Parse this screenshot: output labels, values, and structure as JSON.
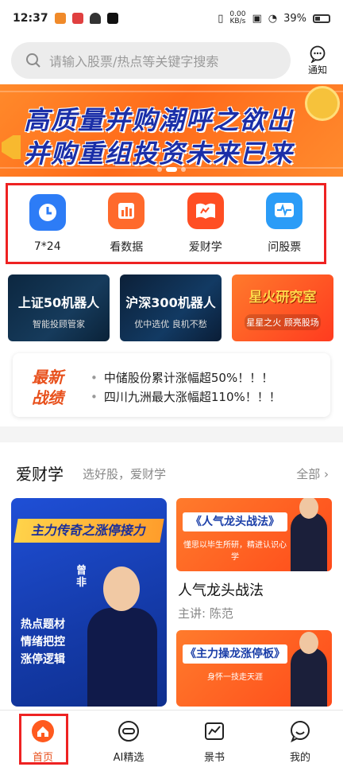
{
  "status": {
    "time": "12:37",
    "speed": "0.00",
    "speed_unit": "KB/s",
    "battery": "39%"
  },
  "search": {
    "placeholder": "请输入股票/热点等关键字搜索",
    "notify_label": "通知"
  },
  "banner": {
    "line1": "高质量并购潮呼之欲出",
    "line2": "并购重组投资未来已来"
  },
  "quick": {
    "items": [
      {
        "label": "7*24",
        "icon": "clock-icon",
        "color": "#2d7cf6"
      },
      {
        "label": "看数据",
        "icon": "chart-icon",
        "color": "#ff6a2c"
      },
      {
        "label": "爱财学",
        "icon": "book-icon",
        "color": "#ff4e23"
      },
      {
        "label": "问股票",
        "icon": "pulse-icon",
        "color": "#2b9cf7"
      }
    ]
  },
  "robots": [
    {
      "title": "上证50机器人",
      "sub": "智能投顾管家"
    },
    {
      "title": "沪深300机器人",
      "sub": "优中选优 良机不愁"
    },
    {
      "title": "星火研究室",
      "sub": "星星之火 顾亮股场"
    }
  ],
  "news": {
    "logo1": "最新",
    "logo2": "战绩",
    "items": [
      "中储股份累计涨幅超50%！！！",
      "四川九洲最大涨幅超110%！！！"
    ]
  },
  "section": {
    "title": "爱财学",
    "subtitle": "选好股，爱财学",
    "all": "全部",
    "big_card": {
      "headline": "主力传奇之涨停接力",
      "name": "曾非",
      "tags": [
        "热点题材",
        "情绪把控",
        "涨停逻辑"
      ]
    },
    "card1": {
      "banner": "《人气龙头战法》",
      "sub": "懂思以毕生所研，精进认识心学",
      "title": "人气龙头战法",
      "teacher": "主讲: 陈范"
    },
    "card2": {
      "banner": "《主力操龙涨停板》",
      "sub": "身怀一技走天涯"
    }
  },
  "tabbar": {
    "items": [
      {
        "label": "首页",
        "icon": "home-icon"
      },
      {
        "label": "AI精选",
        "icon": "ai-icon"
      },
      {
        "label": "景书",
        "icon": "trend-icon"
      },
      {
        "label": "我的",
        "icon": "profile-icon"
      }
    ]
  }
}
